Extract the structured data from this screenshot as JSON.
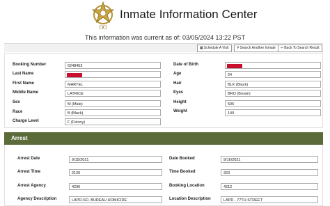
{
  "header": {
    "title": "Inmate Information Center",
    "current_as_of": "This information was current as of: 03/05/2024 13:22 PST"
  },
  "toolbar": {
    "schedule_visit": "Schedule A Visit",
    "search_another": "Search Another Inmate",
    "back_to_results": "Back To Search Result"
  },
  "inmate": {
    "booking_number_label": "Booking Number",
    "booking_number": "6248453",
    "last_name_label": "Last Name",
    "first_name_label": "First Name",
    "first_name": "MARTEL",
    "middle_name_label": "Middle Name",
    "middle_name": "LATRICE",
    "sex_label": "Sex",
    "sex": "M (Male)",
    "race_label": "Race",
    "race": "B (Black)",
    "charge_level_label": "Charge Level",
    "charge_level": "F (Felony)",
    "dob_label": "Date of Birth",
    "age_label": "Age",
    "age": "24",
    "hair_label": "Hair",
    "hair": "BLK (Black)",
    "eyes_label": "Eyes",
    "eyes": "BRO (Brown)",
    "height_label": "Height",
    "height": "506",
    "weight_label": "Weight",
    "weight": "140"
  },
  "arrest": {
    "section_title": "Arrest",
    "arrest_date_label": "Arrest Date",
    "arrest_date": "9/15/2021",
    "arrest_time_label": "Arrest Time",
    "arrest_time": "2120",
    "arrest_agency_label": "Arrest Agency",
    "arrest_agency": "4296",
    "agency_description_label": "Agency Description",
    "agency_description": "LAPD-SO. BUREAU HOMICIDE",
    "date_booked_label": "Date Booked",
    "date_booked": "9/16/2021",
    "time_booked_label": "Time Booked",
    "time_booked": "323",
    "booking_location_label": "Booking Location",
    "booking_location": "4212",
    "location_description_label": "Location Description",
    "location_description": "LAPD - 77TH STREET"
  },
  "colors": {
    "arrest_header_bg": "#5b6b3a",
    "redaction": "#c8102e",
    "badge_gold": "#b8912f"
  },
  "icons": [
    "sheriff-star-badge",
    "calendar-icon",
    "search-icon",
    "back-arrow-icon"
  ]
}
